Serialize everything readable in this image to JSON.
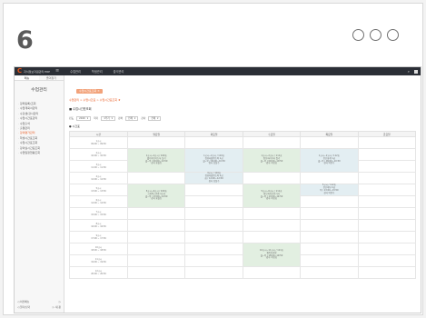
{
  "step_number": "6",
  "window_controls": [
    "circle-1",
    "circle-2",
    "circle-3"
  ],
  "topbar": {
    "logo_mark": "C",
    "logo_text": "지식정보자원관리 ERP",
    "menu_icon": "≡",
    "nav": [
      "수업관리",
      "학생관리",
      "출석관리"
    ],
    "search_icon": "⌕"
  },
  "sidebar": {
    "tabs": [
      "메뉴",
      "즐겨찾기"
    ],
    "title": "수업관리",
    "items": [
      "· 강좌등록/조회",
      "· 수업계획서관리",
      "· 수강생/강사관리",
      "· 수업시간표관리",
      "· 수업출석",
      "· 출결관리",
      "· 강의평가관리",
      "· 학생시간표조회",
      "· 수업시간표조회",
      "· 강의실시간표조회",
      "· 수업일정현황조회"
    ],
    "active_index": 6,
    "bottom": [
      {
        "left": "◁ 이전메뉴",
        "right": "▷"
      },
      {
        "left": "◁ 열기/닫기",
        "right": "▷ 새 창"
      }
    ]
  },
  "main": {
    "tab_label": "수업시간표조회 ✕",
    "breadcrumb": "수업관리 > 수업시간표 > 수업시간표조회 ★",
    "section_title": "■ 수업시간표조회",
    "filters": [
      {
        "label": "년도",
        "value": "2020"
      },
      {
        "label": "학기",
        "value": "1학기"
      },
      {
        "label": "강좌",
        "value": "전체"
      },
      {
        "label": "강사",
        "value": "전체"
      }
    ],
    "sub_title": "● 시간표"
  },
  "timetable": {
    "headers": [
      "시간",
      "월요일",
      "화요일",
      "수요일",
      "목요일",
      "금요일"
    ],
    "rows": [
      {
        "time": "1교시\n09:00 ~ 09:50",
        "cells": [
          "",
          "",
          "",
          "",
          ""
        ]
      },
      {
        "time": "2교시\n10:00 ~ 10:50",
        "cells": [
          "",
          "",
          "",
          "",
          ""
        ]
      },
      {
        "time": "3교시\n11:00 ~ 11:50",
        "cells": [
          "",
          "",
          "",
          "",
          ""
        ]
      },
      {
        "time": "4교시\n12:00 ~ 12:50",
        "cells": [
          "",
          "",
          "",
          "",
          ""
        ]
      },
      {
        "time": "5교시\n13:00 ~ 13:50",
        "cells": [
          "",
          "",
          "",
          "",
          ""
        ]
      },
      {
        "time": "6교시\n14:00 ~ 14:50",
        "cells": [
          "",
          "",
          "",
          "",
          ""
        ]
      },
      {
        "time": "7교시\n15:00 ~ 15:50",
        "cells": [
          "",
          "",
          "",
          "",
          ""
        ]
      },
      {
        "time": "8교시\n16:00 ~ 16:50",
        "cells": [
          "",
          "",
          "",
          "",
          ""
        ]
      },
      {
        "time": "9교시\n17:00 ~ 17:50",
        "cells": [
          "",
          "",
          "",
          "",
          ""
        ]
      },
      {
        "time": "10교시\n18:00 ~ 18:50",
        "cells": [
          "",
          "",
          "",
          "",
          ""
        ]
      },
      {
        "time": "11교시\n19:00 ~ 19:50",
        "cells": [
          "",
          "",
          "",
          "",
          ""
        ]
      },
      {
        "time": "12교시\n20:00 ~ 20:50",
        "cells": [
          "",
          "",
          "",
          "",
          ""
        ]
      }
    ],
    "blocks": [
      {
        "day": 1,
        "rows": [
          1,
          2
        ],
        "color": "green",
        "text": "1교시~2교시 / 109호\n웹디자인기능사 실기\n월~목 / 09:00~10:50\n강사 홍길동"
      },
      {
        "day": 2,
        "rows": [
          1,
          2
        ],
        "color": "blue",
        "text": "1교시~2교시 / 110호\n컴퓨터활용능력 1급\n월~목 / 09:00~10:50\n강사 김철수"
      },
      {
        "day": 3,
        "rows": [
          1,
          2
        ],
        "color": "green",
        "text": "1교시~2교시 / 111호\n정보처리기사 필기\n월~목 / 09:00~10:50\n강사 이영희"
      },
      {
        "day": 4,
        "rows": [
          1,
          2
        ],
        "color": "blue",
        "text": "1교시~2교시 / 112호\n전산회계 1급\n월~목 / 09:00~10:50\n강사 박민수"
      },
      {
        "day": 2,
        "rows": [
          3,
          3
        ],
        "color": "blue",
        "text": "4교시 / 110호\n컴퓨터활용능력 2급\n화 / 12:00~12:50\n강사 김철수"
      },
      {
        "day": 1,
        "rows": [
          4,
          5
        ],
        "color": "green",
        "text": "5교시~6교시 / 109호\n그래픽스운용기능사\n월~목 / 13:00~14:50\n강사 홍길동"
      },
      {
        "day": 3,
        "rows": [
          4,
          5
        ],
        "color": "green",
        "text": "5교시~6교시 / 111호\n정보처리산업기사\n월~목 / 13:00~14:50\n강사 이영희"
      },
      {
        "day": 4,
        "rows": [
          4,
          4
        ],
        "color": "blue",
        "text": "5교시 / 112호\n전산세무 2급\n목 / 13:00~13:50\n강사 박민수"
      },
      {
        "day": 3,
        "rows": [
          9,
          10
        ],
        "color": "green",
        "text": "10교시~11교시 / 111호\n재직자과정\n월~목 / 18:00~19:50\n강사 이영희"
      }
    ]
  }
}
